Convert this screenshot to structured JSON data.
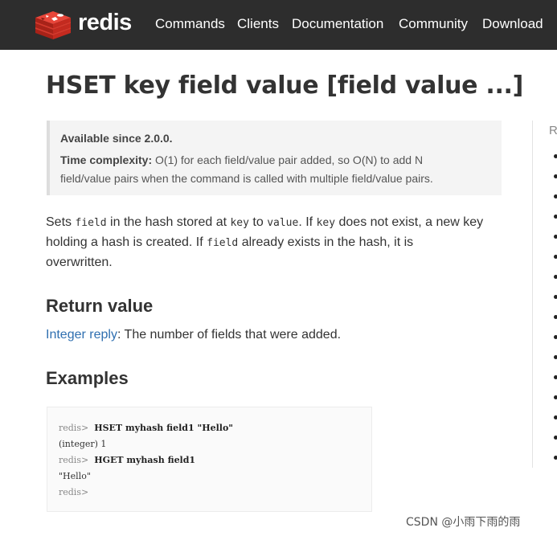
{
  "header": {
    "logo_text": "redis",
    "nav": [
      "Commands",
      "Clients",
      "Documentation",
      "Community",
      "Download"
    ]
  },
  "page_title": "HSET key field value [field value ...]",
  "info": {
    "available_label": "Available since 2.0.0.",
    "complexity_label": "Time complexity:",
    "complexity_line1": "O(1) for each field/value pair added, so O(N) to add N",
    "complexity_line2": "field/value pairs when the command is called with multiple field/value pairs."
  },
  "description": {
    "t1": "Sets ",
    "c1": "field",
    "t2": " in the hash stored at ",
    "c2": "key",
    "t3": " to ",
    "c3": "value",
    "t4": ". If ",
    "c4": "key",
    "t5": " does not exist, a new key",
    "line2": "holding a hash is created. If ",
    "c5": "field",
    "t6": " already exists in the hash, it is",
    "line3": "overwritten."
  },
  "return_value": {
    "heading": "Return value",
    "link_text": "Integer reply",
    "rest": ": The number of fields that were added."
  },
  "examples": {
    "heading": "Examples",
    "lines": [
      {
        "prompt": "redis>",
        "text": "HSET myhash field1 \"Hello\""
      },
      {
        "prompt": "",
        "text": "(integer) 1"
      },
      {
        "prompt": "redis>",
        "text": "HGET myhash field1"
      },
      {
        "prompt": "",
        "text": "\"Hello\""
      },
      {
        "prompt": "redis>",
        "text": ""
      }
    ]
  },
  "sidebar": {
    "letter": "R",
    "bullet_count": 16
  },
  "watermark": "CSDN @小雨下雨的雨",
  "colors": {
    "topbar": "#2d2d2d",
    "logo_red": "#d82c20",
    "link": "#2f6fb0"
  }
}
